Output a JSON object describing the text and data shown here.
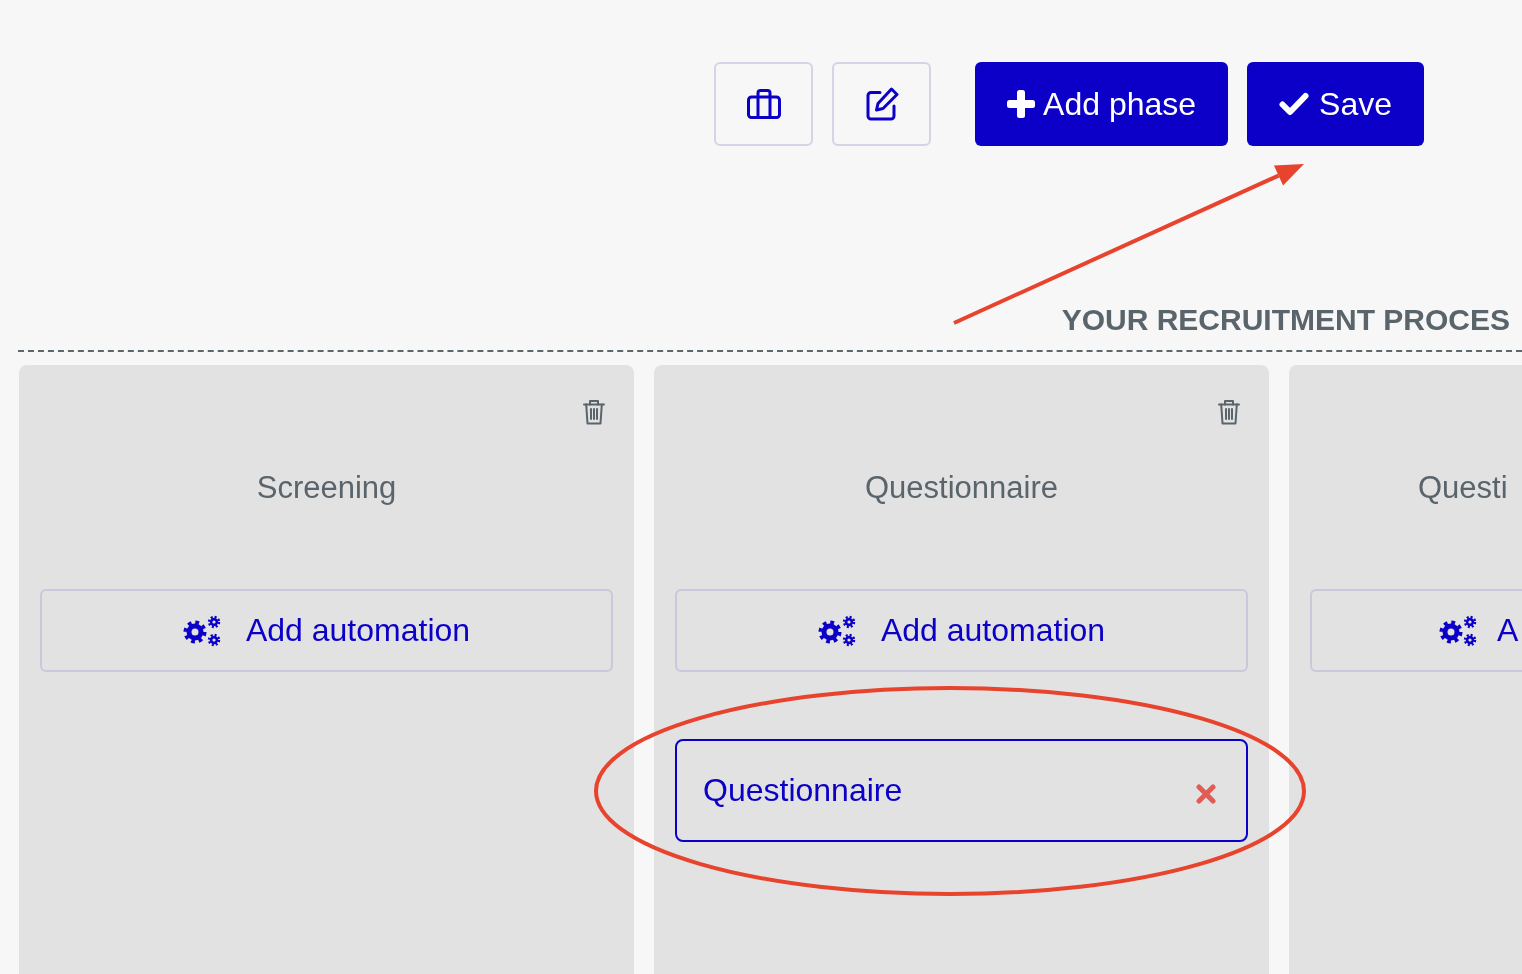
{
  "toolbar": {
    "icon_buttons": [
      {
        "kind": "briefcase"
      },
      {
        "kind": "edit"
      }
    ],
    "buttons": [
      {
        "kind": "add",
        "label": "Add phase"
      },
      {
        "kind": "save",
        "label": "Save"
      }
    ]
  },
  "process": {
    "title": "YOUR RECRUITMENT PROCES",
    "phases": [
      {
        "title": "Screening",
        "deletable": true,
        "automation_label": "Add automation"
      },
      {
        "title": "Questionnaire",
        "deletable": true,
        "automation_label": "Add automation",
        "steps": [
          {
            "label": "Questionnaire"
          }
        ]
      },
      {
        "title": "Questi",
        "deletable": false,
        "automation_label": "A"
      }
    ]
  },
  "annotations": [
    {
      "kind": "arrow"
    },
    {
      "kind": "ellipse"
    }
  ]
}
